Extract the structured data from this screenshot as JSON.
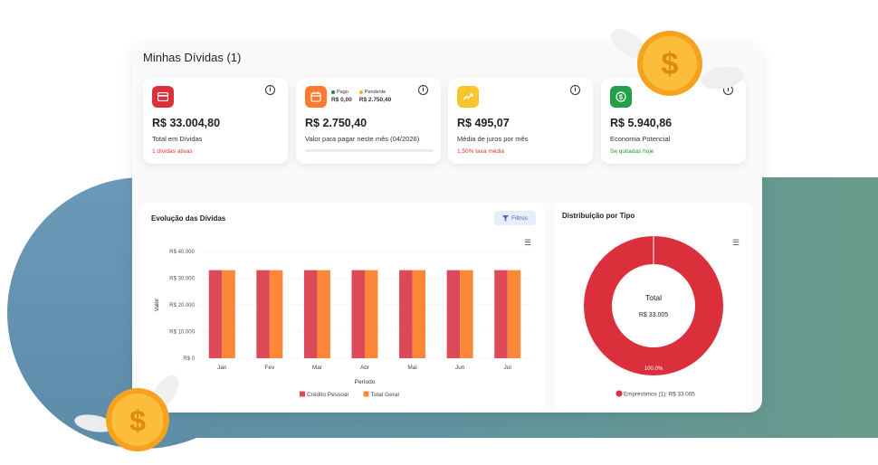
{
  "page": {
    "title": "Minhas Dívidas (1)"
  },
  "cards": [
    {
      "amount": "R$ 33.004,80",
      "label": "Total em Dívidas",
      "sub": "1 dívidas ativas",
      "sub_color": "#e03131",
      "color": "#dc2f3c",
      "icon": "credit-card-icon"
    },
    {
      "amount": "R$ 2.750,40",
      "label": "Valor para pagar neste mês (04/2026)",
      "sub": "",
      "color": "#ff7a2f",
      "icon": "calendar-icon",
      "legend": {
        "paid_label": "Pago",
        "paid_value": "R$ 0,00",
        "paid_color": "#1f8a3a",
        "pending_label": "Pendente",
        "pending_value": "R$ 2.750,40",
        "pending_color": "#f2b31b"
      },
      "progress": 0
    },
    {
      "amount": "R$ 495,07",
      "label": "Média de juros por mês",
      "sub": "1.50% taxa média",
      "sub_color": "#e03131",
      "color": "#f9c52e",
      "icon": "trending-up-icon"
    },
    {
      "amount": "R$ 5.940,86",
      "label": "Economia Potencial",
      "sub": "Se quitadas hoje",
      "sub_color": "#1f9a3a",
      "color": "#22a04a",
      "icon": "dollar-icon"
    }
  ],
  "evolution_chart": {
    "title": "Evolução das Dívidas",
    "filter_label": "Filtros",
    "chart_data": {
      "type": "bar",
      "categories": [
        "Jan",
        "Fev",
        "Mar",
        "Abr",
        "Mai",
        "Jun",
        "Jul"
      ],
      "series": [
        {
          "name": "Crédito Pessoal",
          "values": [
            33005,
            33005,
            33005,
            33005,
            33005,
            33005,
            33005
          ],
          "color": "#dc4a59"
        },
        {
          "name": "Total Geral",
          "values": [
            33005,
            33005,
            33005,
            33005,
            33005,
            33005,
            33005
          ],
          "color": "#fb8838"
        }
      ],
      "yticks": [
        "R$ 0",
        "R$ 10.000",
        "R$ 20.000",
        "R$ 30.000",
        "R$ 40.000"
      ],
      "ylim": [
        0,
        40000
      ],
      "xlabel": "Período",
      "ylabel": "Valor"
    }
  },
  "donut_chart": {
    "title": "Distribuição por Tipo",
    "center_label": "Total",
    "center_value": "R$ 33.005",
    "slice_label": "100.0%",
    "legend": "Empréstimos (1): R$ 33.005",
    "chart_data": {
      "type": "pie",
      "categories": [
        "Empréstimos"
      ],
      "values": [
        100.0
      ],
      "color": "#dc2f3c"
    }
  }
}
